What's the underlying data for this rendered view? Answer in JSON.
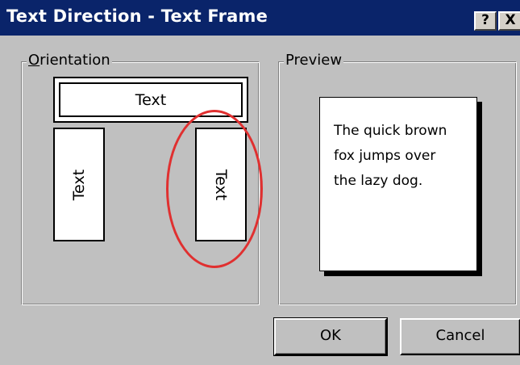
{
  "window": {
    "title": "Text Direction - Text Frame",
    "help_label": "?",
    "close_label": "X"
  },
  "orientation": {
    "legend": "rientation",
    "legend_mnemonic": "O",
    "options": [
      {
        "label": "Text",
        "direction": "horizontal"
      },
      {
        "label": "Text",
        "direction": "vertical-up"
      },
      {
        "label": "Text",
        "direction": "vertical-down",
        "selected_highlight": true
      }
    ]
  },
  "preview": {
    "legend": "Preview",
    "sample_lines": [
      "The quick brown",
      "fox jumps over",
      "the lazy dog."
    ]
  },
  "buttons": {
    "ok": "OK",
    "cancel": "Cancel"
  },
  "colors": {
    "titlebar": "#0a246a",
    "dialog_bg": "#c0c0c0",
    "annotation_circle": "#e03030"
  }
}
